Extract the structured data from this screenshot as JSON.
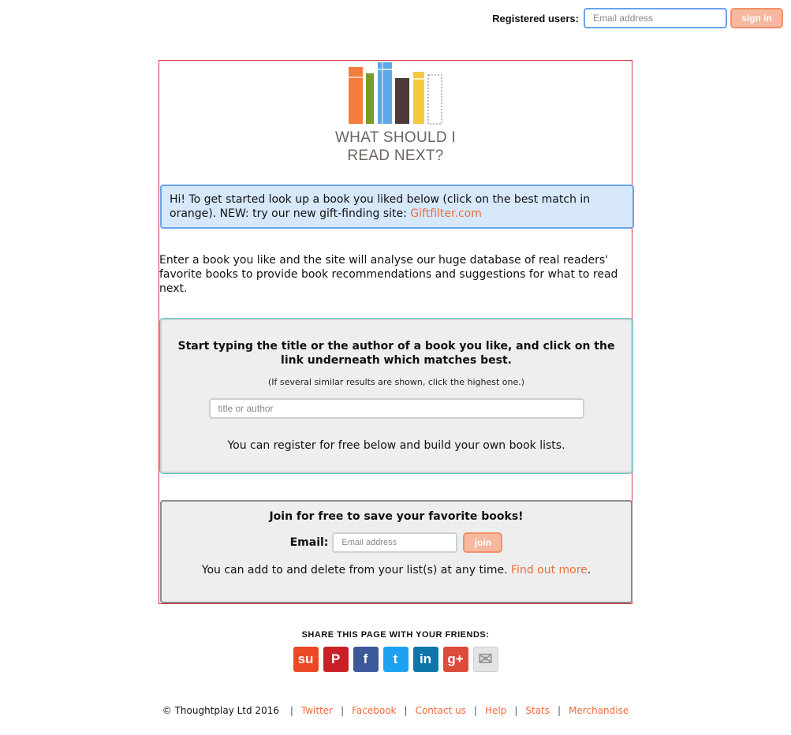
{
  "login": {
    "label": "Registered users:",
    "email_placeholder": "Email address",
    "signin_label": "sign in"
  },
  "logo": {
    "line1": "WHAT SHOULD I",
    "line2": "READ NEXT?"
  },
  "welcome": {
    "text": "Hi! To get started look up a book you liked below (click on the best match in orange). NEW: try our new gift-finding site: ",
    "link": "Giftfilter.com"
  },
  "intro": "Enter a book you like and the site will analyse our huge database of real readers' favorite books to provide book recommendations and suggestions for what to read next.",
  "search": {
    "heading": "Start typing the title or the author of a book you like, and click on the link underneath which matches best.",
    "note": "(If several similar results are shown, click the highest one.)",
    "placeholder": "title or author",
    "register_text": "You can register for free below and build your own book lists."
  },
  "join": {
    "heading": "Join for free to save your favorite books!",
    "email_label": "Email:",
    "email_placeholder": "Email address",
    "join_label": "join",
    "info_text": "You can add to and delete from your list(s) at any time. ",
    "info_link": "Find out more",
    "info_end": "."
  },
  "share": {
    "title": "SHARE THIS PAGE WITH YOUR FRIENDS:",
    "icons": [
      {
        "name": "stumbleupon-icon",
        "glyph": "su",
        "color": "#eb4823"
      },
      {
        "name": "pinterest-icon",
        "glyph": "P",
        "color": "#cb2027"
      },
      {
        "name": "facebook-icon",
        "glyph": "f",
        "color": "#3b5998"
      },
      {
        "name": "twitter-icon",
        "glyph": "t",
        "color": "#1da1f2"
      },
      {
        "name": "linkedin-icon",
        "glyph": "in",
        "color": "#0e76a8"
      },
      {
        "name": "googleplus-icon",
        "glyph": "g+",
        "color": "#dd4b39"
      },
      {
        "name": "email-icon",
        "glyph": "✉",
        "color": "#e4e4e4"
      }
    ]
  },
  "footer": {
    "copyright": "© Thoughtplay Ltd 2016",
    "links": [
      "Twitter",
      "Facebook",
      "Contact us",
      "Help",
      "Stats",
      "Merchandise"
    ]
  },
  "colors": {
    "accent": "#ef6a3c",
    "info_bg": "#d7e8fb",
    "info_border": "#6aa3e8",
    "panel_bg": "#eeeeee"
  }
}
